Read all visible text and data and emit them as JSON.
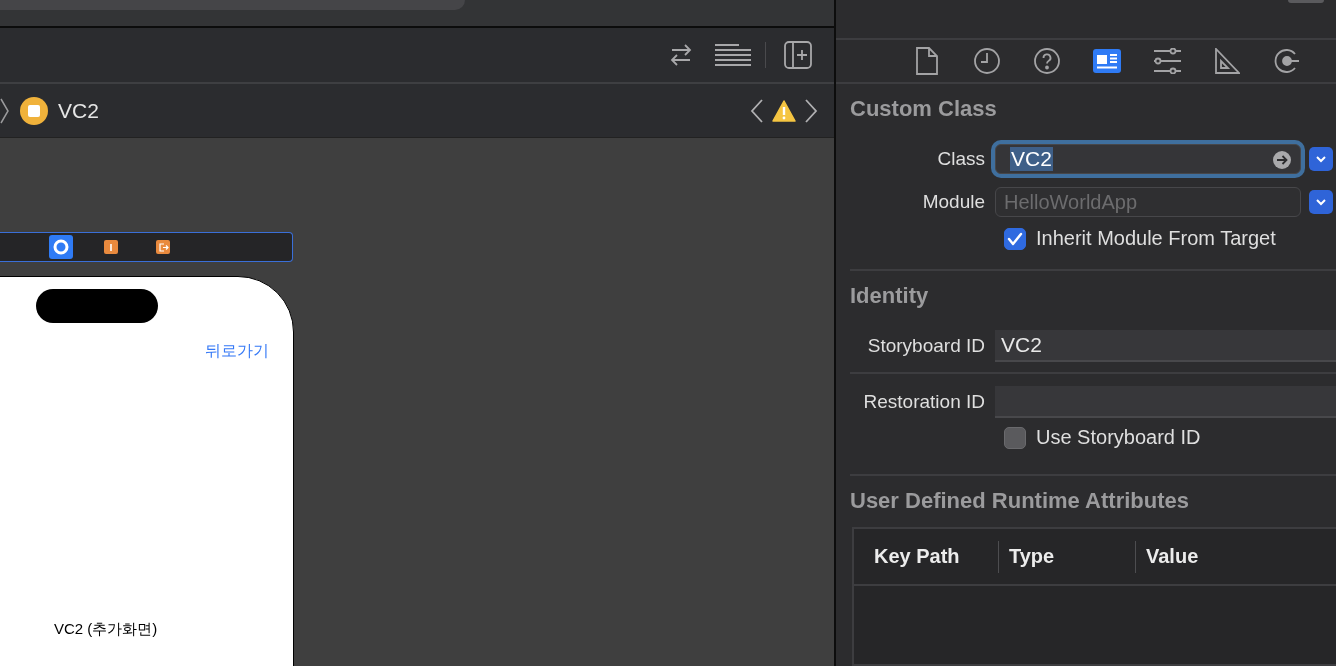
{
  "editor": {
    "breadcrumb": {
      "label": "VC2"
    },
    "scene": {
      "back_button": "뒤로가기",
      "screen_label": "VC2 (추가화면)"
    }
  },
  "inspector": {
    "tabs": [
      {
        "selected": false
      },
      {
        "selected": false
      },
      {
        "selected": false
      },
      {
        "selected": true
      },
      {
        "selected": false
      },
      {
        "selected": false
      },
      {
        "selected": false
      }
    ],
    "custom_class": {
      "title": "Custom Class",
      "class": {
        "label": "Class",
        "value": "VC2",
        "focused": true
      },
      "module": {
        "label": "Module",
        "placeholder": "HelloWorldApp"
      },
      "inherit": {
        "label": "Inherit Module From Target",
        "checked": true
      }
    },
    "identity": {
      "title": "Identity",
      "storyboard_id": {
        "label": "Storyboard ID",
        "value": "VC2"
      },
      "restoration_id": {
        "label": "Restoration ID"
      },
      "use_storyboard_id": {
        "label": "Use Storyboard ID",
        "checked": false
      }
    },
    "runtime_attributes": {
      "title": "User Defined Runtime Attributes",
      "columns": [
        "Key Path",
        "Type",
        "Value"
      ]
    }
  }
}
